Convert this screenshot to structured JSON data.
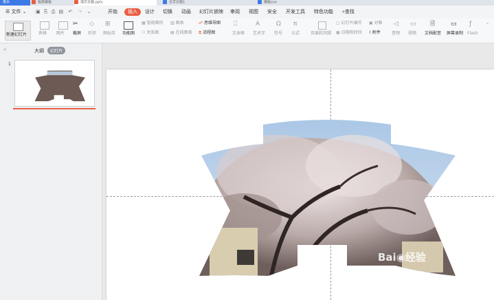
{
  "tabs": [
    {
      "label": "首页",
      "color": "#3d7ae6"
    },
    {
      "label": "稻壳模板",
      "color": "#e95e43"
    },
    {
      "label": "演示文稿.pptx",
      "color": "#e95e43"
    },
    {
      "label": "文字文稿1",
      "color": "#3d7ae6"
    },
    {
      "label": "模板xxx",
      "color": "#3d7ae6"
    }
  ],
  "menubar": {
    "file_label": "文件",
    "items": [
      "开始",
      "插入",
      "设计",
      "切换",
      "动画",
      "幻灯片放映",
      "审阅",
      "视图",
      "安全",
      "开发工具",
      "特色功能"
    ],
    "active": "插入",
    "search_label": "查找"
  },
  "ribbon": {
    "new_slide": "新建幻灯片",
    "table": "表格",
    "picture": "图片",
    "screenshot": "截屏",
    "shape": "形状",
    "icon_lib": "图标库",
    "func_chart": "功能图",
    "smart_shape": "智能图形",
    "chart": "图表",
    "relation": "关系图",
    "online_chart": "在线图表",
    "mind_map": "思维导图",
    "flowchart": "流程图",
    "textbox": "文本框",
    "art_text": "艺术字",
    "symbol": "符号",
    "formula": "公式",
    "header_footer": "页眉和页脚",
    "slide_number": "幻灯片编号",
    "object": "对象",
    "datetime": "日期和时间",
    "attachment": "附件",
    "audio": "音频",
    "video": "视频",
    "text_dub": "文档配音",
    "screen_rec": "屏幕录制",
    "flash": "Flash"
  },
  "panel": {
    "outline_tab": "大纲",
    "slides_tab": "幻灯片",
    "slide_number": "1"
  },
  "colors": {
    "accent": "#e95e43",
    "sky": "#8fb5dd"
  }
}
